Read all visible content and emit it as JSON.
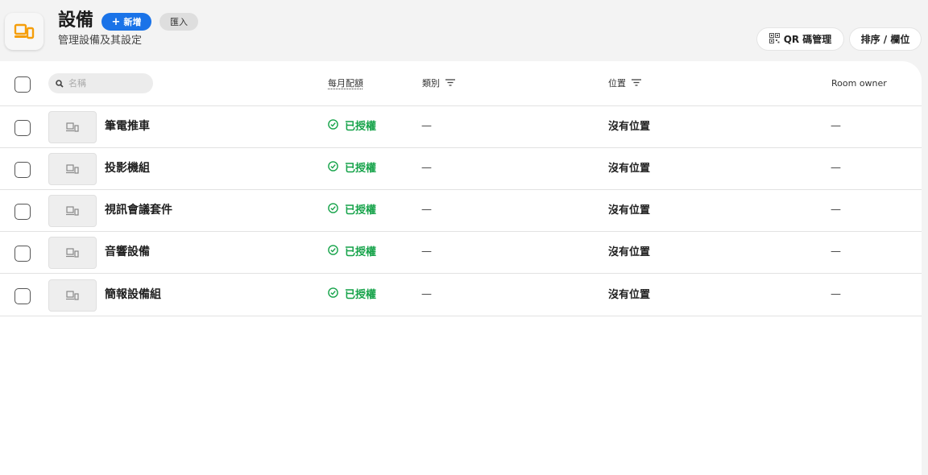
{
  "header": {
    "title": "設備",
    "subtitle": "管理設備及其設定",
    "new_button": "新增",
    "import_button": "匯入",
    "qr_button": "QR 碼管理",
    "sort_button": "排序 / 欄位",
    "brand_color": "#f59e0b",
    "primary_color": "#1a73e8"
  },
  "table": {
    "search_placeholder": "名稱",
    "columns": {
      "quota": "每月配額",
      "category": "類別",
      "location": "位置",
      "owner": "Room owner"
    },
    "rows": [
      {
        "name": "筆電推車",
        "status": "已授權",
        "category": "—",
        "location": "沒有位置",
        "owner": "—"
      },
      {
        "name": "投影機組",
        "status": "已授權",
        "category": "—",
        "location": "沒有位置",
        "owner": "—"
      },
      {
        "name": "視訊會議套件",
        "status": "已授權",
        "category": "—",
        "location": "沒有位置",
        "owner": "—"
      },
      {
        "name": "音響設備",
        "status": "已授權",
        "category": "—",
        "location": "沒有位置",
        "owner": "—"
      },
      {
        "name": "簡報設備組",
        "status": "已授權",
        "category": "—",
        "location": "沒有位置",
        "owner": "—"
      }
    ],
    "status_color": "#16a34a"
  }
}
